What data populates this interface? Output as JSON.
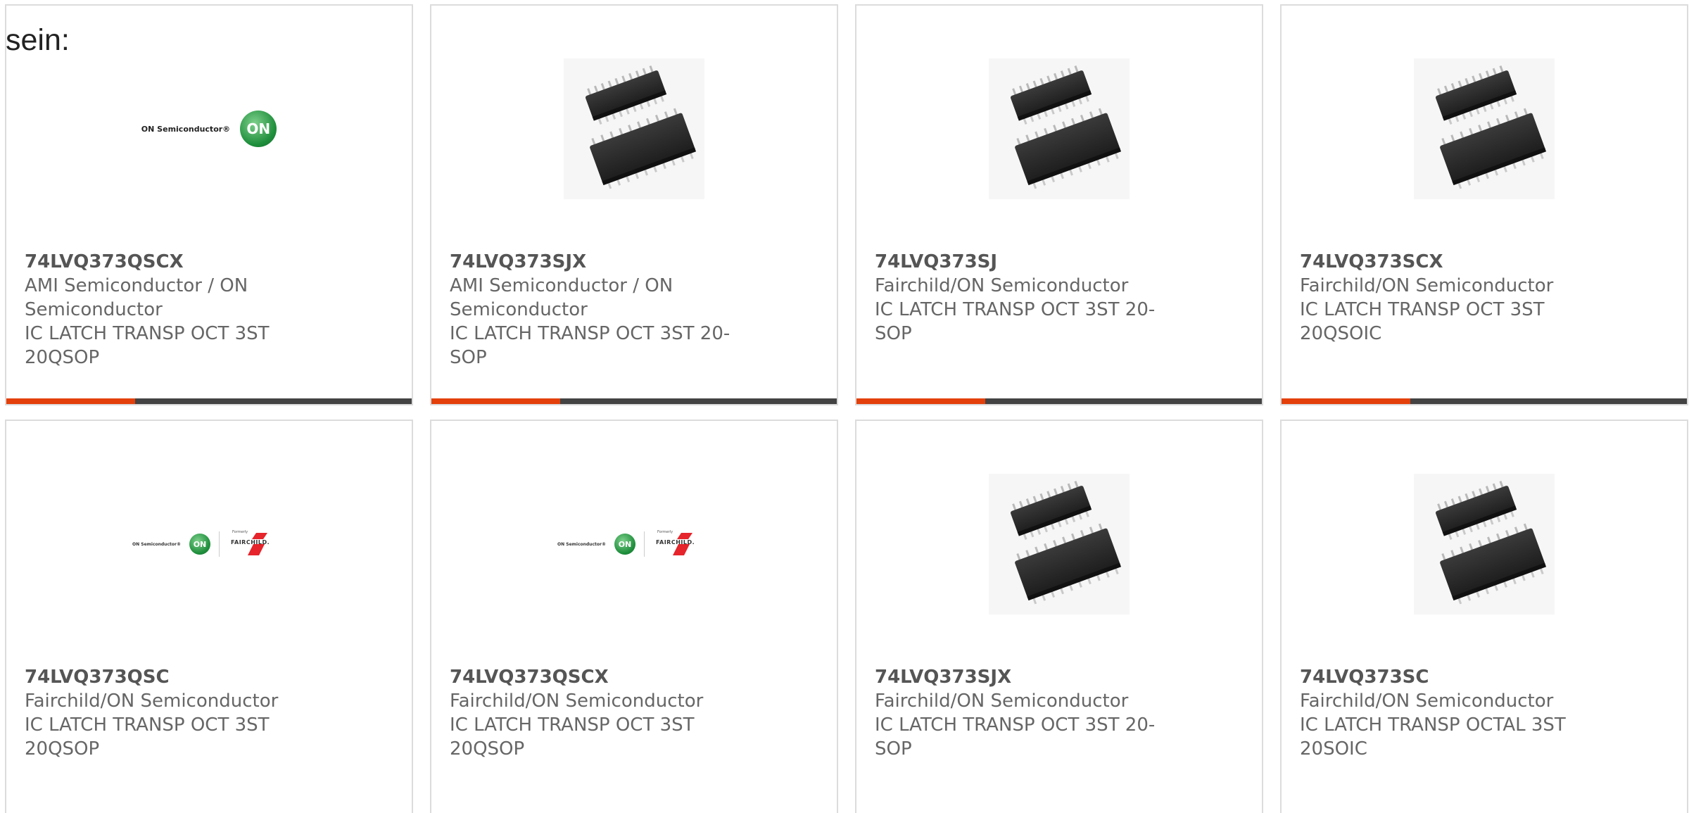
{
  "intro_text": "sein:",
  "products": [
    {
      "part_number": "74LVQ373QSCX",
      "manufacturer": "AMI Semiconductor / ON Semiconductor",
      "description": "IC LATCH TRANSP OCT 3ST 20QSOP",
      "image": "on-semiconductor-logo",
      "logo_text": "ON Semiconductor®",
      "logo_mark": "ON"
    },
    {
      "part_number": "74LVQ373SJX",
      "manufacturer": "AMI Semiconductor / ON Semiconductor",
      "description": "IC LATCH TRANSP OCT 3ST 20-SOP",
      "image": "ic-chip-photo"
    },
    {
      "part_number": "74LVQ373SJ",
      "manufacturer": "Fairchild/ON Semiconductor",
      "description": "IC LATCH TRANSP OCT 3ST 20-SOP",
      "image": "ic-chip-photo"
    },
    {
      "part_number": "74LVQ373SCX",
      "manufacturer": "Fairchild/ON Semiconductor",
      "description": "IC LATCH TRANSP OCT 3ST 20QSOIC",
      "image": "ic-chip-photo"
    },
    {
      "part_number": "74LVQ373QSC",
      "manufacturer": "Fairchild/ON Semiconductor",
      "description": "IC LATCH TRANSP OCT 3ST 20QSOP",
      "image": "on-fairchild-logo",
      "logo_text": "ON Semiconductor®",
      "logo_mark": "ON",
      "formerly": "Formerly",
      "fairchild": "FAIRCHILD."
    },
    {
      "part_number": "74LVQ373QSCX",
      "manufacturer": "Fairchild/ON Semiconductor",
      "description": "IC LATCH TRANSP OCT 3ST 20QSOP",
      "image": "on-fairchild-logo",
      "logo_text": "ON Semiconductor®",
      "logo_mark": "ON",
      "formerly": "Formerly",
      "fairchild": "FAIRCHILD."
    },
    {
      "part_number": "74LVQ373SJX",
      "manufacturer": "Fairchild/ON Semiconductor",
      "description": "IC LATCH TRANSP OCT 3ST 20-SOP",
      "image": "ic-chip-photo"
    },
    {
      "part_number": "74LVQ373SC",
      "manufacturer": "Fairchild/ON Semiconductor",
      "description": "IC LATCH TRANSP OCTAL 3ST 20SOIC",
      "image": "ic-chip-photo"
    }
  ],
  "colors": {
    "accent": "#e3400b",
    "bar": "#434343",
    "border": "#dcdcdc",
    "text": "#666666"
  }
}
